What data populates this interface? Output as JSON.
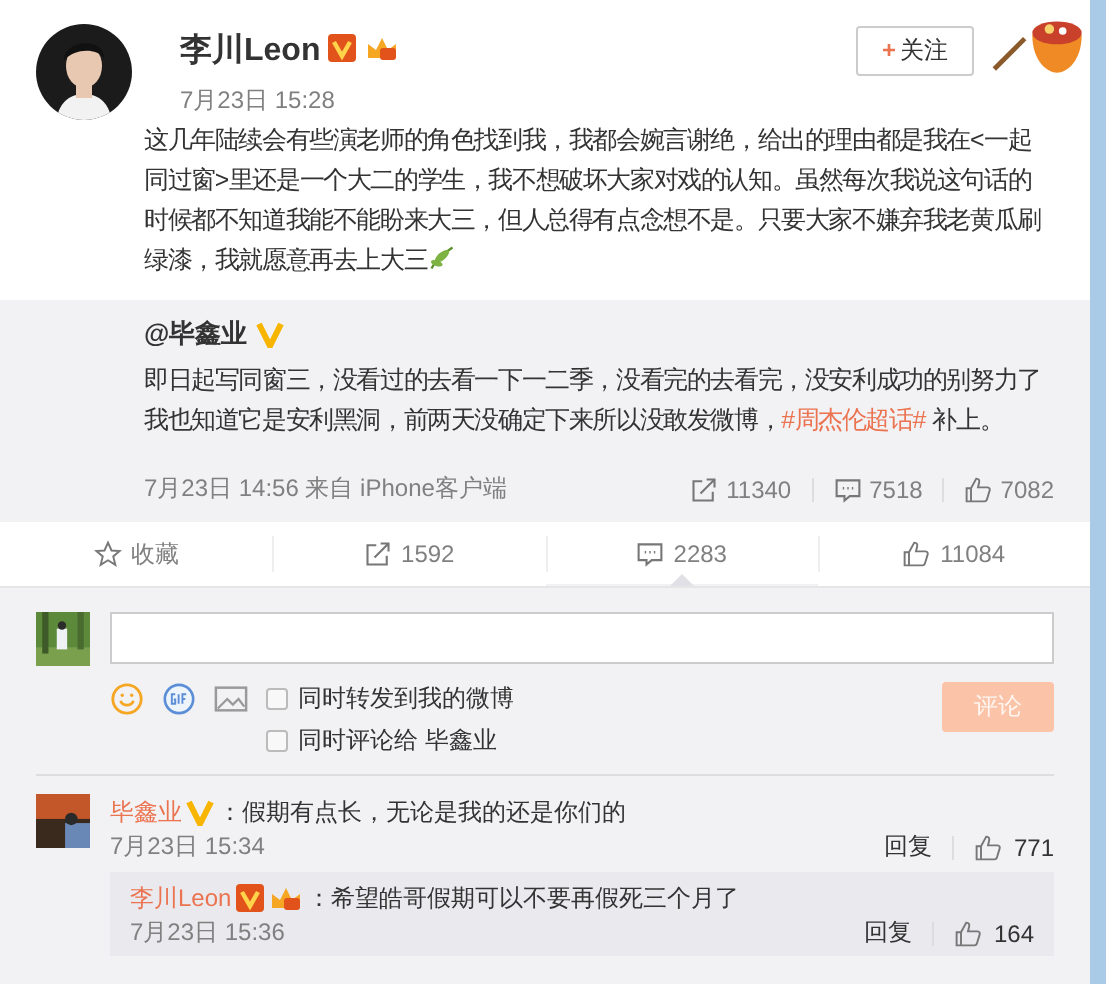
{
  "post": {
    "author": "李川Leon",
    "badges": [
      {
        "kind": "orange_v"
      },
      {
        "kind": "crown"
      }
    ],
    "time": "7月23日 15:28",
    "follow": {
      "icon": "+",
      "label": "关注"
    },
    "text": "这几年陆续会有些演老师的角色找到我，我都会婉言谢绝，给出的理由都是我在<一起同过窗>里还是一个大二的学生，我不想破坏大家对戏的认知。虽然每次我说这句话的时候都不知道我能不能盼来大三，但人总得有点念想不是。只要大家不嫌弃我老黄瓜刷绿漆，我就愿意再去上大三"
  },
  "repost": {
    "author": "@毕鑫业",
    "badges": [
      {
        "kind": "yellow_v"
      }
    ],
    "text_before": "即日起写同窗三，没看过的去看一下一二季，没看完的去看完，没安利成功的别努力了我也知道它是安利黑洞，前两天没确定下来所以没敢发微博，",
    "hashtag": "#周杰伦超话#",
    "text_after": " 补上。",
    "time": "7月23日 14:56 来自 iPhone客户端",
    "shares": "11340",
    "comments": "7518",
    "likes": "7082"
  },
  "actions": [
    {
      "kind": "favorite",
      "label": "收藏",
      "selected": false
    },
    {
      "kind": "share",
      "label": "1592",
      "selected": false
    },
    {
      "kind": "comment",
      "label": "2283",
      "selected": true
    },
    {
      "kind": "like",
      "label": "11084",
      "selected": false
    }
  ],
  "composer": {
    "options": [
      {
        "label": "同时转发到我的微博",
        "checked": false
      },
      {
        "label": "同时评论给 毕鑫业",
        "checked": false
      }
    ],
    "submit": {
      "label": "评论",
      "disabled": true
    }
  },
  "comments": [
    {
      "author": "毕鑫业",
      "badges": [
        {
          "kind": "yellow_v"
        }
      ],
      "text": "：假期有点长，无论是我的还是你们的",
      "time": "7月23日 15:34",
      "reply": "回复",
      "likes": "771",
      "replies": [
        {
          "author": "李川Leon",
          "badges": [
            {
              "kind": "orange_v"
            },
            {
              "kind": "crown"
            }
          ],
          "text": "：希望皓哥假期可以不要再假死三个月了",
          "time": "7月23日 15:36",
          "reply": "回复",
          "likes": "164"
        }
      ]
    }
  ]
}
